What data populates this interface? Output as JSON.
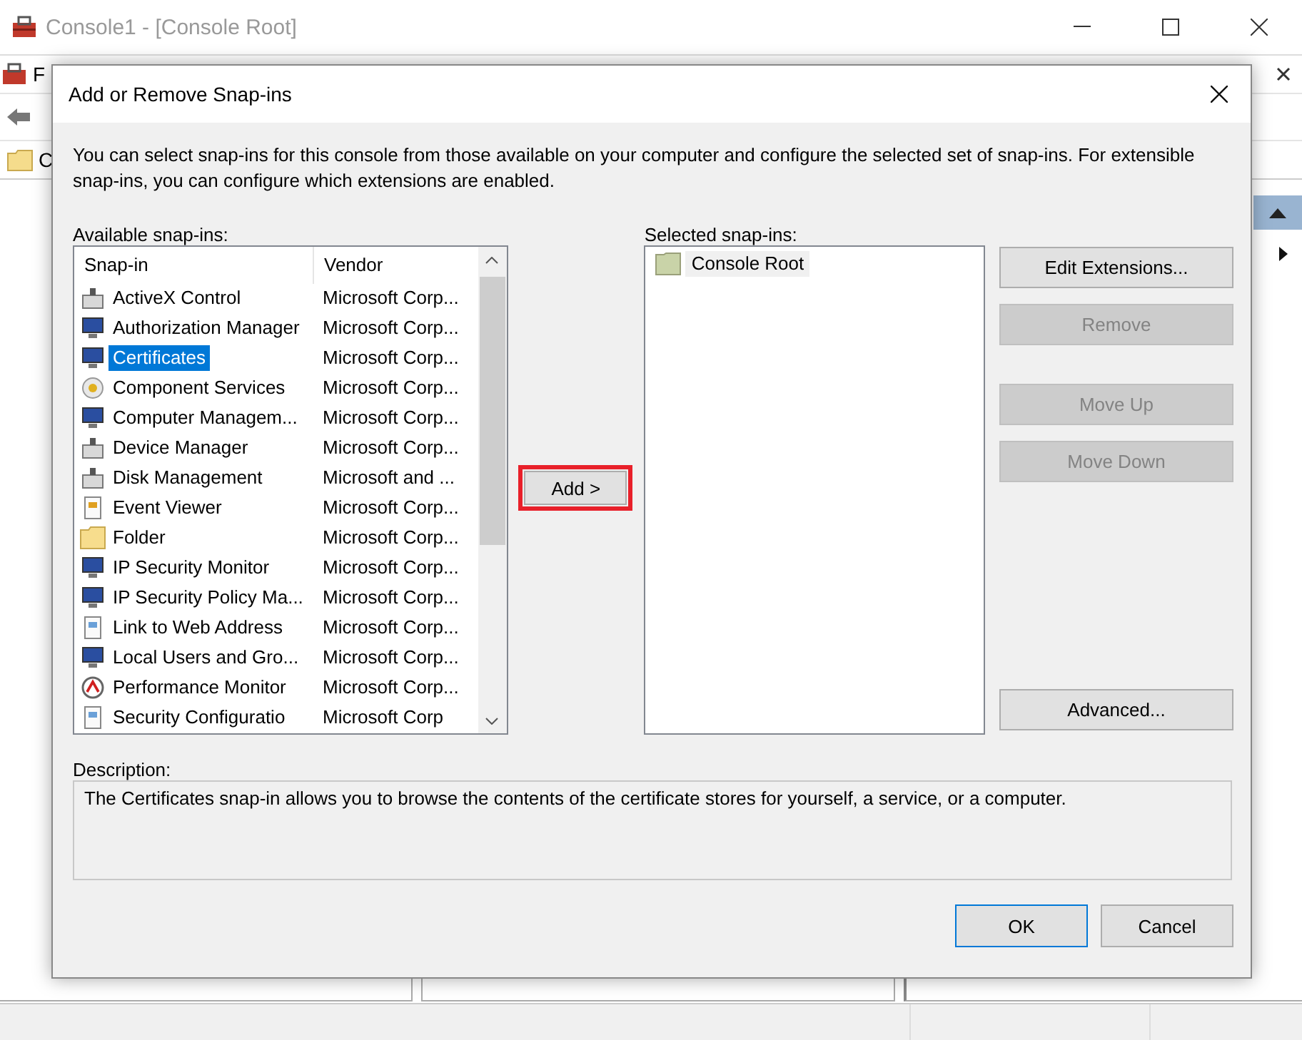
{
  "console_window": {
    "title": "Console1 - [Console Root]",
    "menu_first": "F",
    "tree_first": "C"
  },
  "dialog": {
    "title": "Add or Remove Snap-ins",
    "intro": "You can select snap-ins for this console from those available on your computer and configure the selected set of snap-ins. For extensible snap-ins, you can configure which extensions are enabled.",
    "available_label": "Available snap-ins:",
    "columns": [
      "Snap-in",
      "Vendor"
    ],
    "snapins": [
      {
        "name": "ActiveX Control",
        "vendor": "Microsoft Corp...",
        "selected": false
      },
      {
        "name": "Authorization Manager",
        "vendor": "Microsoft Corp...",
        "selected": false
      },
      {
        "name": "Certificates",
        "vendor": "Microsoft Corp...",
        "selected": true
      },
      {
        "name": "Component Services",
        "vendor": "Microsoft Corp...",
        "selected": false
      },
      {
        "name": "Computer Managem...",
        "vendor": "Microsoft Corp...",
        "selected": false
      },
      {
        "name": "Device Manager",
        "vendor": "Microsoft Corp...",
        "selected": false
      },
      {
        "name": "Disk Management",
        "vendor": "Microsoft and ...",
        "selected": false
      },
      {
        "name": "Event Viewer",
        "vendor": "Microsoft Corp...",
        "selected": false
      },
      {
        "name": "Folder",
        "vendor": "Microsoft Corp...",
        "selected": false
      },
      {
        "name": "IP Security Monitor",
        "vendor": "Microsoft Corp...",
        "selected": false
      },
      {
        "name": "IP Security Policy Ma...",
        "vendor": "Microsoft Corp...",
        "selected": false
      },
      {
        "name": "Link to Web Address",
        "vendor": "Microsoft Corp...",
        "selected": false
      },
      {
        "name": "Local Users and Gro...",
        "vendor": "Microsoft Corp...",
        "selected": false
      },
      {
        "name": "Performance Monitor",
        "vendor": "Microsoft Corp...",
        "selected": false
      },
      {
        "name": "Security Configuratio",
        "vendor": "Microsoft Corp",
        "selected": false
      }
    ],
    "add_button": {
      "label": "Add >",
      "highlighted": true
    },
    "selected_label": "Selected snap-ins:",
    "selected_items": [
      {
        "name": "Console Root"
      }
    ],
    "side_buttons": [
      {
        "label": "Edit Extensions...",
        "disabled": false
      },
      {
        "label": "Remove",
        "disabled": true
      },
      {
        "label": "Move Up",
        "disabled": true
      },
      {
        "label": "Move Down",
        "disabled": true
      },
      {
        "label": "Advanced...",
        "disabled": false
      }
    ],
    "description_label": "Description:",
    "description": "The Certificates snap-in allows you to browse the contents of the certificate stores for yourself, a service, or a computer.",
    "buttons": [
      {
        "label": "OK",
        "default": true
      },
      {
        "label": "Cancel",
        "default": false
      }
    ]
  }
}
